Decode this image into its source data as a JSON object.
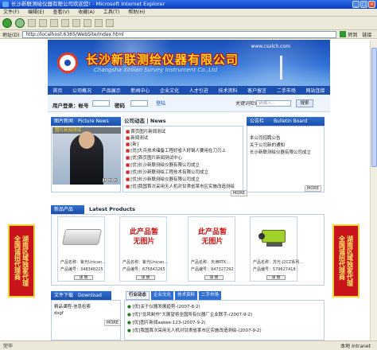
{
  "window": {
    "title": "长沙新联测绘仪器有限公司欢迎您! - Microsoft Internet Explorer"
  },
  "menu": [
    "文件(F)",
    "编辑(E)",
    "查看(V)",
    "收藏(A)",
    "工具(T)",
    "帮助(H)"
  ],
  "address": {
    "label": "地址(D)",
    "value": "http://localhost:6365/WebSite/Index.html",
    "go_label": "转到",
    "links_label": "链接"
  },
  "banner": {
    "company": "长沙新联测绘仪器有限公司",
    "company_en": "Changsha Xinlian Survey Instrument Co.,Ltd",
    "url": "www.csxlch.com"
  },
  "nav": [
    "首页",
    "公司概况",
    "产品展示",
    "新闻中心",
    "企业文化",
    "人才引进",
    "技术资料",
    "客户留言",
    "二手市场",
    "网站连接"
  ],
  "login": {
    "label": "用户登录：帐号",
    "password_label": "密码",
    "login_btn": "登陆",
    "search_label": "关键词检索",
    "search_placeholder": "请输入...",
    "search_btn": "搜索"
  },
  "picnews": {
    "title": "图片新闻",
    "title_en": "Picture News",
    "caption": "图片新闻测试"
  },
  "company_news": {
    "title": "公司动态 | News",
    "items": [
      "首页图片新闻测试",
      "新闻测试",
      "[新]",
      "[优]大兵技术储备工程好省人好钢人要用在刀刃上",
      "[优]首页图片新闻测试中心",
      "[优]长沙新联测绘仪器有限公司成立",
      "[优]长沙新联测绘工程技术有限公司成立",
      "[优]长沙新联测绘仪器有限公司成立",
      "[优]我国首次采用无人机对甘肃省某市区实施改造测绘"
    ],
    "more": "MORE"
  },
  "bulletin": {
    "title": "公告栏",
    "title_en": "Bulletin Board",
    "items": [
      "本公司招聘公告",
      "关于公司新的通知",
      "长沙新联测绘仪器有限公司成立"
    ],
    "more": "MORE"
  },
  "products": {
    "title": "新品产品",
    "title_en": "Latest Products",
    "items": [
      {
        "name_label": "产品名称：",
        "name": "紫光Unican...",
        "code_label": "产品编号：",
        "code": "348348225",
        "pic": "scanner"
      },
      {
        "name_label": "产品名称：",
        "name": "紫光Unican...",
        "code_label": "产品编号：",
        "code": "675843265",
        "pic": "noimg"
      },
      {
        "name_label": "产品名称：",
        "name": "天津RTK...",
        "code_label": "产品编号：",
        "code": "947327292",
        "pic": "noimg"
      },
      {
        "name_label": "产品名称：",
        "name": "苏光-J2CZ系列...",
        "code_label": "产品编号：",
        "code": "579627418",
        "pic": "level"
      }
    ],
    "noimg_text": "此产品暂无图片",
    "detail": "详 情"
  },
  "side_left": {
    "col1": "全国诚招代理商",
    "col2": "湖南区域独家代理"
  },
  "side_right": {
    "col1": "全国诚招代理商",
    "col2": "湖南区域独家代理"
  },
  "download": {
    "title": "文件下载",
    "title_en": "Download",
    "items": [
      "精品课程-信息检索",
      "dsgf"
    ],
    "more": "MORE"
  },
  "culture_tabs": [
    "行业动态",
    "企业文化",
    "技术资料",
    "二手市场"
  ],
  "culture_items": [
    "[优]关于仪器发展趋势-(2007-8-2)",
    "[优]\"龙风制作\"大展望将全国所有仪器厂企业联手-(2007-9-2)",
    "[优]图片新闻aakee-123-(2007-9-2)",
    "[优]我国首次采用无人机对甘肃省某市区实施改造测绘-(2007-9-2)"
  ],
  "status": {
    "text": "完毕",
    "zone": "本地 Intranet"
  }
}
